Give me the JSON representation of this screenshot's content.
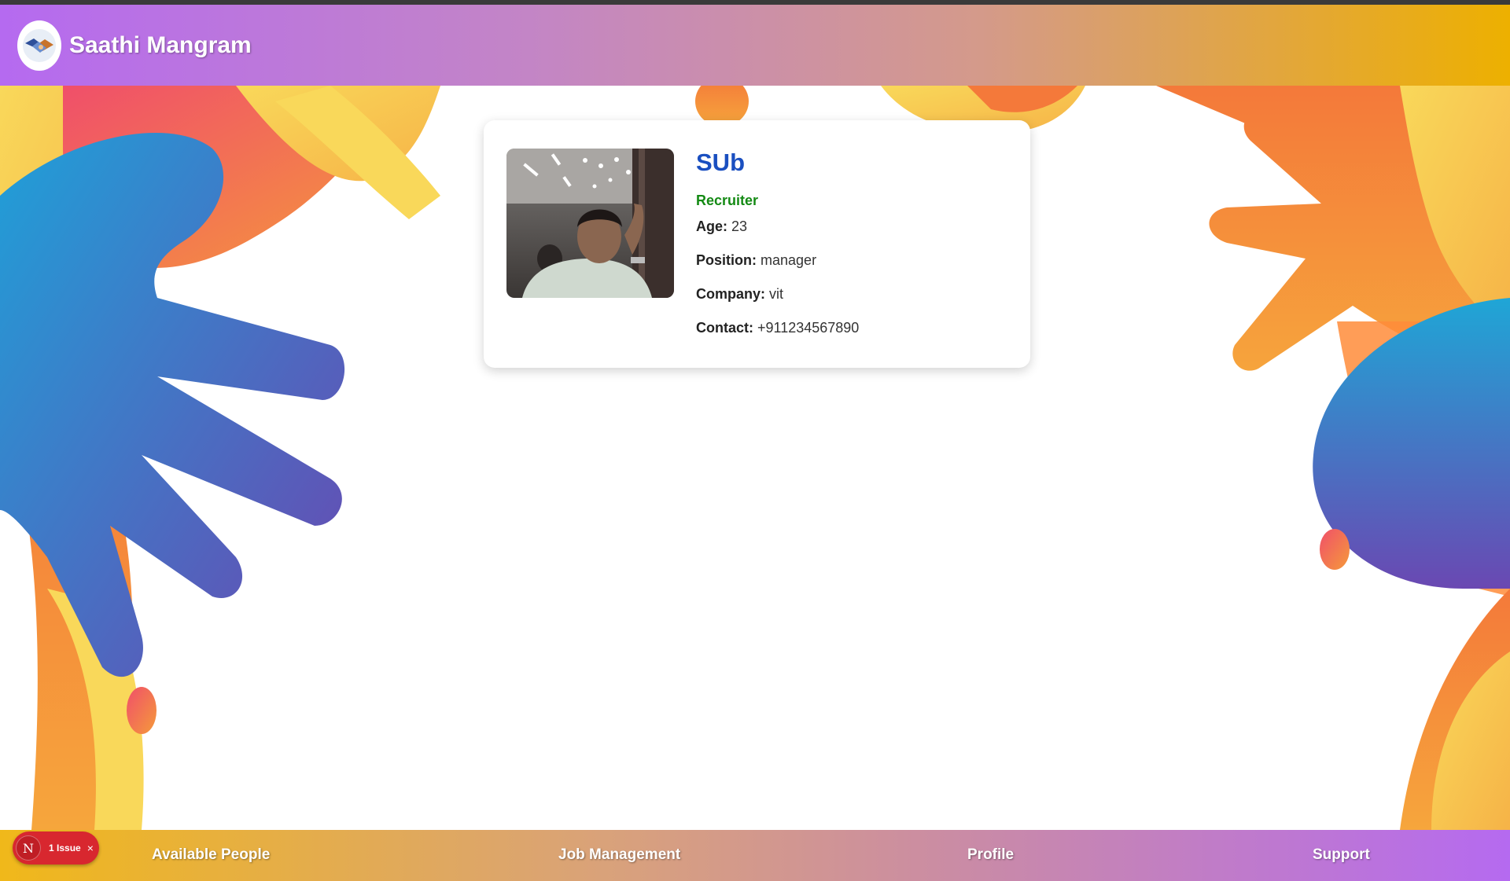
{
  "app": {
    "title": "Saathi Mangram",
    "logo_icon": "handshake-icon"
  },
  "profile": {
    "name": "SUb",
    "role": "Recruiter",
    "fields": [
      {
        "label": "Age:",
        "value": "23"
      },
      {
        "label": "Position:",
        "value": "manager"
      },
      {
        "label": "Company:",
        "value": "vit"
      },
      {
        "label": "Contact:",
        "value": "+911234567890"
      }
    ]
  },
  "nav": {
    "items": [
      {
        "label": "Available People"
      },
      {
        "label": "Job Management"
      },
      {
        "label": "Profile"
      },
      {
        "label": "Support"
      }
    ]
  },
  "issue_badge": {
    "letter": "N",
    "text": "1 Issue",
    "close": "×"
  },
  "colors": {
    "header_start": "#b56af0",
    "header_end": "#edb000",
    "name": "#1a4fc0",
    "role": "#148a14",
    "badge": "#d8272f"
  }
}
